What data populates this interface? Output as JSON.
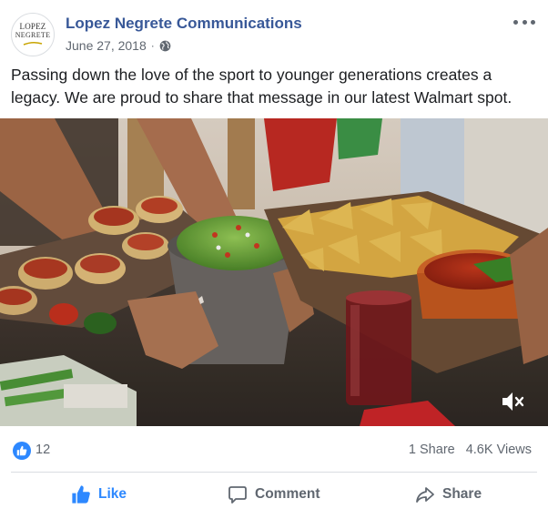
{
  "post": {
    "author": "Lopez Negrete Communications",
    "logo": {
      "line1": "LOPEZ",
      "line2": "NEGRETE"
    },
    "date": "June 27, 2018",
    "separator": "·",
    "privacy_icon": "globe-icon",
    "text": "Passing down the love of the sport to younger generations creates a legacy. We are proud to share that message in our latest Walmart spot."
  },
  "video": {
    "muted_icon": "speaker-muted-icon"
  },
  "stats": {
    "reaction_icon": "thumbs-up-icon",
    "reaction_count": "12",
    "shares": "1 Share",
    "views": "4.6K Views"
  },
  "actions": {
    "like": "Like",
    "comment": "Comment",
    "share": "Share"
  },
  "colors": {
    "brand_blue": "#385898",
    "like_blue": "#2d88ff",
    "meta_gray": "#606770"
  }
}
